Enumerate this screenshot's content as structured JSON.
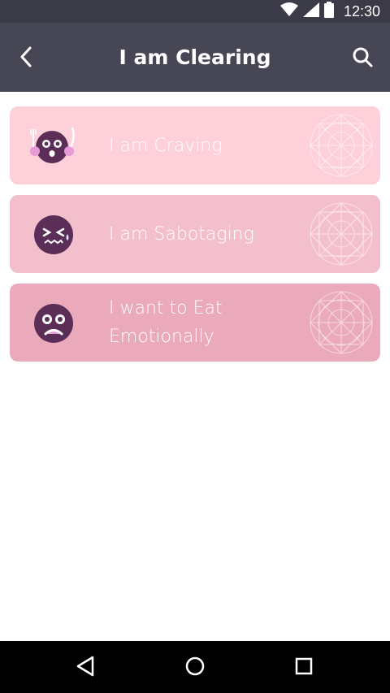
{
  "status_bar": {
    "time": "12:30",
    "icons": [
      "wifi-icon",
      "cell-signal-icon",
      "battery-icon"
    ]
  },
  "header": {
    "title": "I am Clearing",
    "back_icon": "chevron-left-icon",
    "search_icon": "search-icon",
    "background": "#474655"
  },
  "cards": [
    {
      "label": "I am Craving",
      "face": "craving-face-icon",
      "color": "#fdd0da"
    },
    {
      "label": "I am Sabotaging",
      "face": "sabotaging-face-icon",
      "color": "#f4bfcc"
    },
    {
      "label": "I want to Eat Emotionally",
      "face": "emotional-face-icon",
      "color": "#ebaabb"
    }
  ],
  "nav_bar": {
    "icons": [
      "back-triangle-icon",
      "home-circle-icon",
      "recents-square-icon"
    ]
  },
  "colors": {
    "face": "#5b2e57",
    "status_bar": "#3b3b47"
  }
}
